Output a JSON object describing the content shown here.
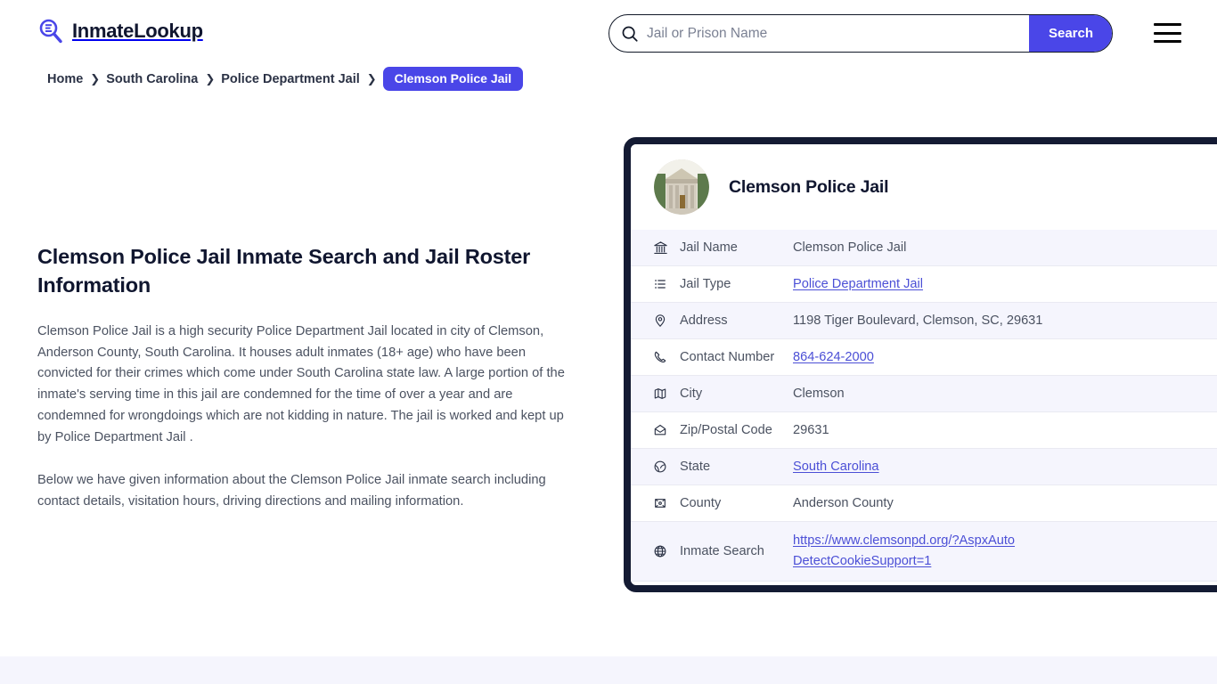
{
  "brand": {
    "name": "InmateLookup",
    "icon": "search-logo-icon"
  },
  "search": {
    "placeholder": "Jail or Prison Name",
    "value": "",
    "button_label": "Search",
    "icon": "search-icon"
  },
  "menu": {
    "icon": "hamburger-menu-icon"
  },
  "breadcrumb": {
    "items": [
      {
        "label": "Home",
        "current": false
      },
      {
        "label": "South Carolina",
        "current": false
      },
      {
        "label": "Police Department Jail",
        "current": false
      },
      {
        "label": "Clemson Police Jail",
        "current": true
      }
    ],
    "separator": "❯"
  },
  "main": {
    "title": "Clemson Police Jail Inmate Search and Jail Roster Information",
    "paragraphs": [
      "Clemson Police Jail is a high security Police Department Jail located in city of Clemson, Anderson County, South Carolina. It houses adult inmates (18+ age) who have been convicted for their crimes which come under South Carolina state law. A large portion of the inmate's serving time in this jail are condemned for the time of over a year and are condemned for wrongdoings which are not kidding in nature. The jail is worked and kept up by Police Department Jail .",
      "Below we have given information about the Clemson Police Jail inmate search including contact details, visitation hours, driving directions and mailing information."
    ]
  },
  "card": {
    "avatar_icon": "courthouse-photo",
    "title": "Clemson Police Jail",
    "rows": [
      {
        "icon": "bank-icon",
        "label": "Jail Name",
        "value": "Clemson Police Jail",
        "link": false
      },
      {
        "icon": "list-icon",
        "label": "Jail Type",
        "value": "Police Department Jail",
        "link": true
      },
      {
        "icon": "map-pin-icon",
        "label": "Address",
        "value": "1198 Tiger Boulevard, Clemson, SC, 29631",
        "link": false
      },
      {
        "icon": "phone-icon",
        "label": "Contact Number",
        "value": "864-624-2000",
        "link": true
      },
      {
        "icon": "map-icon",
        "label": "City",
        "value": "Clemson",
        "link": false
      },
      {
        "icon": "envelope-icon",
        "label": "Zip/Postal Code",
        "value": "29631",
        "link": false
      },
      {
        "icon": "globe-icon",
        "label": "State",
        "value": "South Carolina",
        "link": true
      },
      {
        "icon": "county-icon",
        "label": "County",
        "value": "Anderson County",
        "link": false
      },
      {
        "icon": "world-icon",
        "label": "Inmate Search",
        "value": "https://www.clemsonpd.org/?AspxAutoDetectCookieSupport=1",
        "link": true
      }
    ]
  },
  "colors": {
    "accent": "#4a46e8",
    "link": "#4b4fd6",
    "card_border": "#141b33",
    "row_alt": "#f5f5fd",
    "heading": "#10162f",
    "body_text": "#4b5261"
  }
}
